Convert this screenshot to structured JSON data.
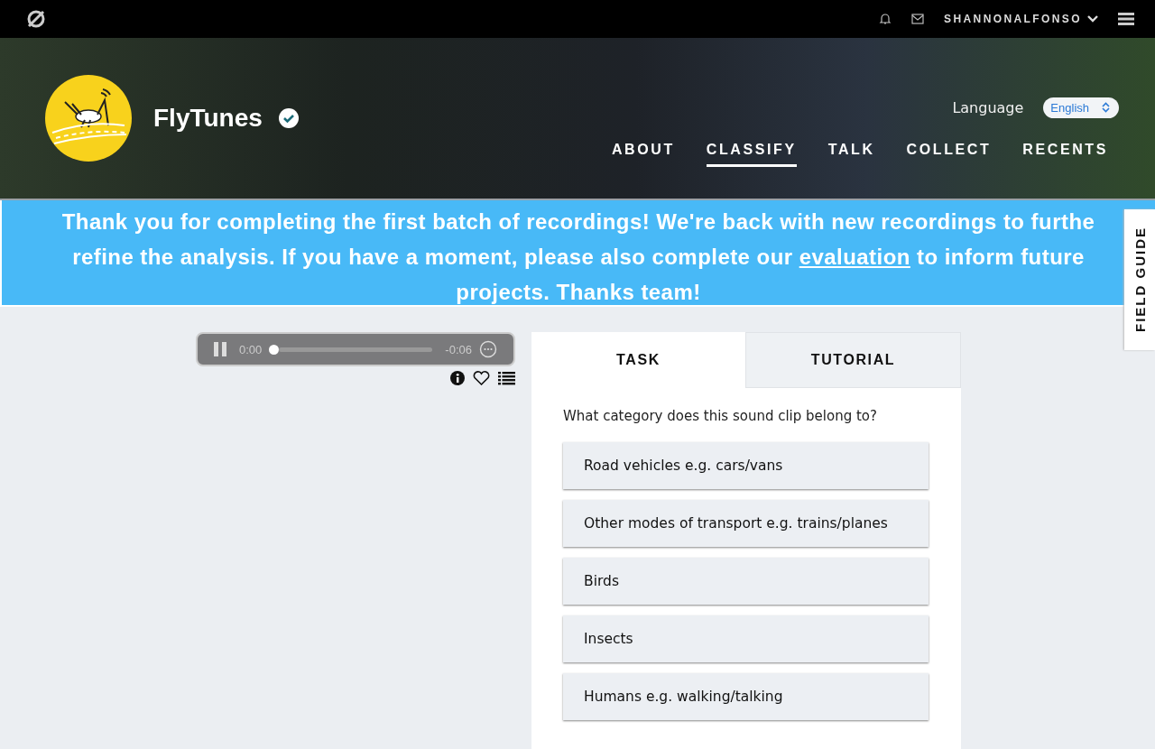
{
  "top_bar": {
    "username": "SHANNONALFONSO"
  },
  "project": {
    "title": "FlyTunes",
    "verified": true,
    "language_label": "Language",
    "language": "English",
    "nav": [
      {
        "label": "ABOUT",
        "selected": false
      },
      {
        "label": "CLASSIFY",
        "selected": true
      },
      {
        "label": "TALK",
        "selected": false
      },
      {
        "label": "COLLECT",
        "selected": false
      },
      {
        "label": "RECENTS",
        "selected": false
      }
    ]
  },
  "banner": {
    "before": "Thank you for completing the first batch of recordings! We're back with new recordings to furthe refine the analysis. If you have a moment, please also complete our",
    "link": "evaluation",
    "after": "to inform future projects. Thanks team!"
  },
  "player": {
    "elapsed": "0:00",
    "remaining": "-0:06",
    "level": 0,
    "playing": true
  },
  "field_guide": "FIELD GUIDE",
  "task_tabs": [
    {
      "label": "TASK",
      "selected": true
    },
    {
      "label": "TUTORIAL",
      "selected": false
    }
  ],
  "question": "What category does this sound clip belong to?",
  "answers": [
    {
      "label": "Road vehicles e.g. cars/vans"
    },
    {
      "label": "Other modes of transport e.g. trains/planes"
    },
    {
      "label": "Birds"
    },
    {
      "label": "Insects"
    },
    {
      "label": "Humans e.g. walking/talking"
    }
  ]
}
